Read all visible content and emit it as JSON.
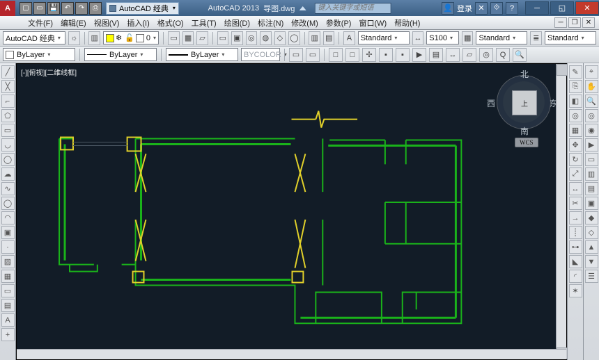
{
  "title": {
    "app": "AutoCAD 2013",
    "doc": "导图.dwg",
    "workspace": "AutoCAD 经典"
  },
  "search_placeholder": "键入关键字或短语",
  "login_label": "登录",
  "menu": [
    "文件(F)",
    "编辑(E)",
    "视图(V)",
    "插入(I)",
    "格式(O)",
    "工具(T)",
    "绘图(D)",
    "标注(N)",
    "修改(M)",
    "参数(P)",
    "窗口(W)",
    "帮助(H)"
  ],
  "toolbar1": {
    "workspace": "AutoCAD 经典",
    "layer0": "0"
  },
  "styles": {
    "text": "Standard",
    "dim": "S100",
    "table": "Standard",
    "ml": "Standard"
  },
  "layer_row": {
    "layer_combo": "ByLayer",
    "linetype": "ByLayer",
    "lineweight": "ByLayer",
    "color_label": "BYCOLOR"
  },
  "drawing_tab": "[-][俯视][二维线框]",
  "viewcube": {
    "top": "北",
    "left": "西",
    "right": "东",
    "bottom": "南",
    "face": "上",
    "wcs": "WCS"
  }
}
